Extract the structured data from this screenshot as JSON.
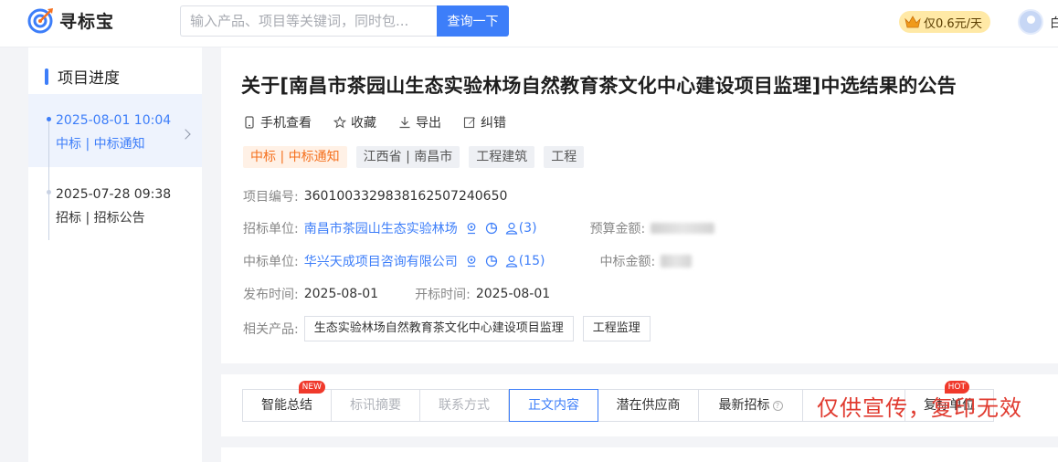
{
  "header": {
    "logo_text": "寻标宝",
    "search_placeholder": "输入产品、项目等关键词，同时包...",
    "search_button": "查询一下",
    "vip_label": "仅0.6元/天",
    "user_name": "白"
  },
  "progress": {
    "title": "项目进度",
    "steps": [
      {
        "date": "2025-08-01 10:04",
        "type": "中标 | 中标通知"
      },
      {
        "date": "2025-07-28 09:38",
        "type": "招标 | 招标公告"
      }
    ]
  },
  "notice": {
    "title": "关于[南昌市茶园山生态实验林场自然教育茶文化中心建设项目监理]中选结果的公告",
    "actions": [
      "手机查看",
      "收藏",
      "导出",
      "纠错"
    ],
    "tags": [
      "中标 | 中标通知",
      "江西省 | 南昌市",
      "工程建筑",
      "工程"
    ],
    "project_no_label": "项目编号:",
    "project_no": "360100332983816250724065​0",
    "tender_unit_label": "招标单位:",
    "tender_unit": "南昌市茶园山生态实验林场",
    "tender_contacts": "(3)",
    "budget_label": "预算金额:",
    "winner_label": "中标单位:",
    "winner": "华兴天成项目咨询有限公司",
    "winner_contacts": "(15)",
    "win_amount_label": "中标金额:",
    "publish_label": "发布时间:",
    "publish_date": "2025-08-01",
    "open_label": "开标时间:",
    "open_date": "2025-08-01",
    "products_label": "相关产品:",
    "products": [
      "生态实验林场自然教育茶文化中心建设项目监理",
      "工程监理"
    ]
  },
  "tabs": {
    "items": [
      "智能总结",
      "标讯摘要",
      "联系方式",
      "正文内容",
      "潜在供应商",
      "最新招标",
      "",
      "复标单位"
    ],
    "new_badge": "NEW",
    "hot_badge": "HOT",
    "help_glyph": "?"
  },
  "watermark": "仅供宣传，复印无效",
  "colors": {
    "accent": "#3d7ef9",
    "tag_orange": "#f5711f",
    "watermark": "#e03a2f",
    "vip_bg": "#ffe9a6"
  }
}
